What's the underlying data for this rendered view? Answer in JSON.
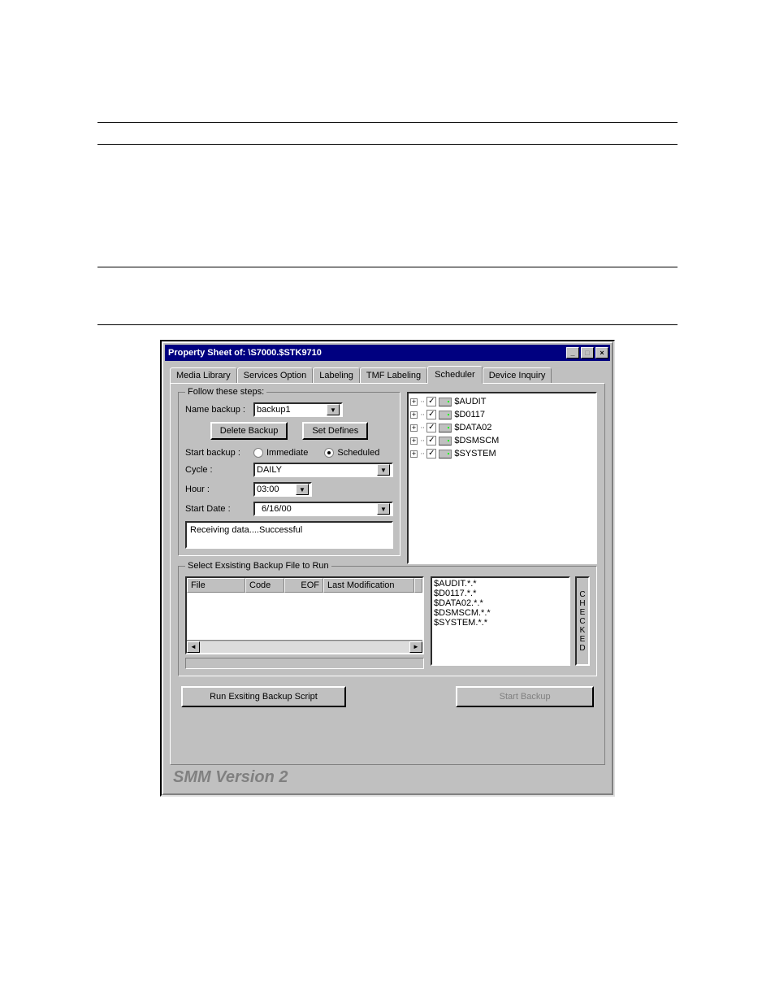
{
  "window": {
    "title": "Property Sheet of: \\S7000.$STK9710"
  },
  "tabs": [
    "Media Library",
    "Services Option",
    "Labeling",
    "TMF Labeling",
    "Scheduler",
    "Device Inquiry"
  ],
  "active_tab": "Scheduler",
  "group_follow": "Follow these steps:",
  "name_backup_label": "Name backup :",
  "name_backup_value": "backup1",
  "delete_backup_btn": "Delete Backup",
  "set_defines_btn": "Set Defines",
  "start_backup_label": "Start backup :",
  "radio_immediate": "Immediate",
  "radio_scheduled": "Scheduled",
  "cycle_label": "Cycle :",
  "cycle_value": "DAILY",
  "hour_label": "Hour :",
  "hour_value": "03:00",
  "start_date_label": "Start Date :",
  "start_date_value": "6/16/00",
  "status_text": "Receiving data....Successful",
  "tree_items": [
    "$AUDIT",
    "$D0117",
    "$DATA02",
    "$DSMSCM",
    "$SYSTEM"
  ],
  "group_select": "Select Exsisting Backup File to Run",
  "lv_cols": [
    "File",
    "Code",
    "EOF",
    "Last Modification"
  ],
  "list_items": [
    "$AUDIT.*.*",
    "$D0117.*.*",
    "$DATA02.*.*",
    "$DSMSCM.*.*",
    "$SYSTEM.*.*"
  ],
  "checked_label": "CHECKED",
  "run_btn": "Run Exsiting Backup Script",
  "start_btn": "Start Backup",
  "brand": "SMM Version 2"
}
